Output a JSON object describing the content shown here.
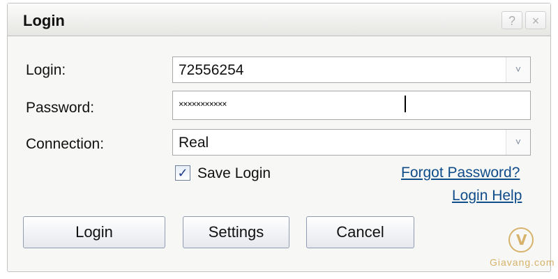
{
  "dialog": {
    "title": "Login"
  },
  "titlebar": {
    "help_glyph": "?",
    "close_glyph": "×"
  },
  "form": {
    "login_label": "Login:",
    "login_value": "72556254",
    "password_label": "Password:",
    "password_value": "×××××××××××",
    "connection_label": "Connection:",
    "connection_value": "Real",
    "save_login_label": "Save Login",
    "save_login_checked": true,
    "checkmark": "✓"
  },
  "links": {
    "forgot_password": "Forgot Password?",
    "login_help": "Login Help"
  },
  "buttons": {
    "login": "Login",
    "settings": "Settings",
    "cancel": "Cancel"
  },
  "watermark": {
    "brand": "Giavang.com",
    "logo_glyph": "V"
  },
  "icons": {
    "dropdown": "chevron-down-icon"
  },
  "colors": {
    "link": "#0f4c8a",
    "watermark": "#d7b26a"
  }
}
